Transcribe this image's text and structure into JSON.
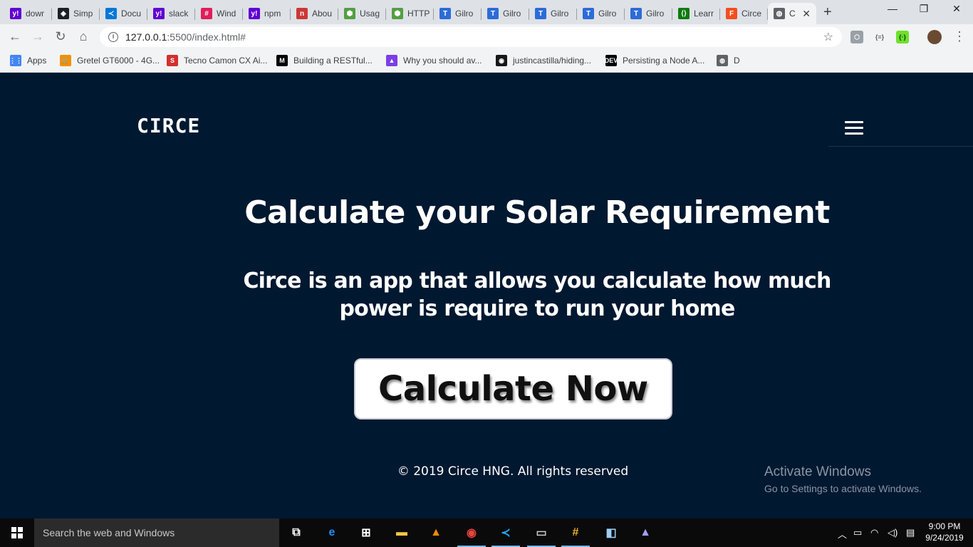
{
  "browser": {
    "tabs": [
      {
        "label": "dowr",
        "icon": "yahoo-icon",
        "color": "#6001d2",
        "glyph": "y!"
      },
      {
        "label": "Simp",
        "icon": "codepen-icon",
        "color": "#1e1f26",
        "glyph": "◈"
      },
      {
        "label": "Docu",
        "icon": "vscode-icon",
        "color": "#0078d7",
        "glyph": "≺"
      },
      {
        "label": "slack",
        "icon": "yahoo-icon",
        "color": "#6001d2",
        "glyph": "y!"
      },
      {
        "label": "Wind",
        "icon": "slack-icon",
        "color": "#e01e5a",
        "glyph": "#"
      },
      {
        "label": "npm",
        "icon": "yahoo-icon",
        "color": "#6001d2",
        "glyph": "y!"
      },
      {
        "label": "Abou",
        "icon": "npm-icon",
        "color": "#cb3837",
        "glyph": "n"
      },
      {
        "label": "Usag",
        "icon": "nodejs-icon",
        "color": "#539e43",
        "glyph": "⬢"
      },
      {
        "label": "HTTP",
        "icon": "nodejs-icon",
        "color": "#539e43",
        "glyph": "⬢"
      },
      {
        "label": "Gilro",
        "icon": "typekit-icon",
        "color": "#2d6bd8",
        "glyph": "T"
      },
      {
        "label": "Gilro",
        "icon": "typekit-icon",
        "color": "#2d6bd8",
        "glyph": "T"
      },
      {
        "label": "Gilro",
        "icon": "typekit-icon",
        "color": "#2d6bd8",
        "glyph": "T"
      },
      {
        "label": "Gilro",
        "icon": "typekit-icon",
        "color": "#2d6bd8",
        "glyph": "T"
      },
      {
        "label": "Gilro",
        "icon": "typekit-icon",
        "color": "#2d6bd8",
        "glyph": "T"
      },
      {
        "label": "Learr",
        "icon": "learn-icon",
        "color": "#0d7a0d",
        "glyph": "⟨⟩"
      },
      {
        "label": "Circe",
        "icon": "figma-icon",
        "color": "#f24e1e",
        "glyph": "F"
      },
      {
        "label": "C",
        "icon": "globe-icon",
        "color": "#5f6368",
        "glyph": "◍",
        "active": true
      }
    ],
    "new_tab": "+",
    "minimize": "—",
    "maximize": "❐",
    "close": "✕",
    "url_host": "127.0.0.1",
    "url_path": ":5500/index.html#",
    "bookmarks": [
      {
        "label": "Apps",
        "icon": "apps-grid-icon",
        "color": "#4285f4",
        "glyph": "⋮⋮"
      },
      {
        "label": "Gretel GT6000 - 4G...",
        "icon": "cart-icon",
        "color": "#f29100",
        "glyph": "🛒"
      },
      {
        "label": "Tecno Camon CX Ai...",
        "icon": "slot-icon",
        "color": "#d32f2f",
        "glyph": "S"
      },
      {
        "label": "Building a RESTful...",
        "icon": "medium-icon",
        "color": "#000000",
        "glyph": "M"
      },
      {
        "label": "Why you should av...",
        "icon": "rocket-icon",
        "color": "#7b3fe4",
        "glyph": "▲"
      },
      {
        "label": "justincastilla/hiding...",
        "icon": "github-icon",
        "color": "#181717",
        "glyph": "◉"
      },
      {
        "label": "Persisting a Node A...",
        "icon": "dev-icon",
        "color": "#000000",
        "glyph": "DEV"
      },
      {
        "label": "D",
        "icon": "globe-icon",
        "color": "#5f6368",
        "glyph": "◍"
      }
    ]
  },
  "page": {
    "logo": "CIRCE",
    "title": "Calculate your Solar Requirement",
    "subtitle": "Circe is an app that allows you calculate how much power is require to run your home",
    "cta_label": "Calculate Now",
    "footer": "© 2019 Circe HNG. All rights reserved"
  },
  "watermark": {
    "line1": "Activate Windows",
    "line2": "Go to Settings to activate Windows."
  },
  "taskbar": {
    "search_placeholder": "Search the web and Windows",
    "time": "9:00 PM",
    "date": "9/24/2019",
    "apps": [
      {
        "name": "task-view-icon",
        "glyph": "⧉",
        "color": "#ffffff"
      },
      {
        "name": "edge-icon",
        "glyph": "e",
        "color": "#1e90ff"
      },
      {
        "name": "store-icon",
        "glyph": "⊞",
        "color": "#ffffff"
      },
      {
        "name": "file-explorer-icon",
        "glyph": "▬",
        "color": "#f2c744"
      },
      {
        "name": "vlc-icon",
        "glyph": "▲",
        "color": "#f08b00"
      },
      {
        "name": "chrome-icon",
        "glyph": "◉",
        "color": "#e8453c",
        "running": true
      },
      {
        "name": "vscode-icon",
        "glyph": "≺",
        "color": "#23a9f2",
        "running": true
      },
      {
        "name": "terminal-icon",
        "glyph": "▭",
        "color": "#c8c8c8",
        "running": true
      },
      {
        "name": "slack-icon",
        "glyph": "#",
        "color": "#ecb22e",
        "running": true
      },
      {
        "name": "notepad-icon",
        "glyph": "◧",
        "color": "#9ad0f5"
      },
      {
        "name": "inkscape-icon",
        "glyph": "▲",
        "color": "#a0a0ff"
      }
    ]
  }
}
